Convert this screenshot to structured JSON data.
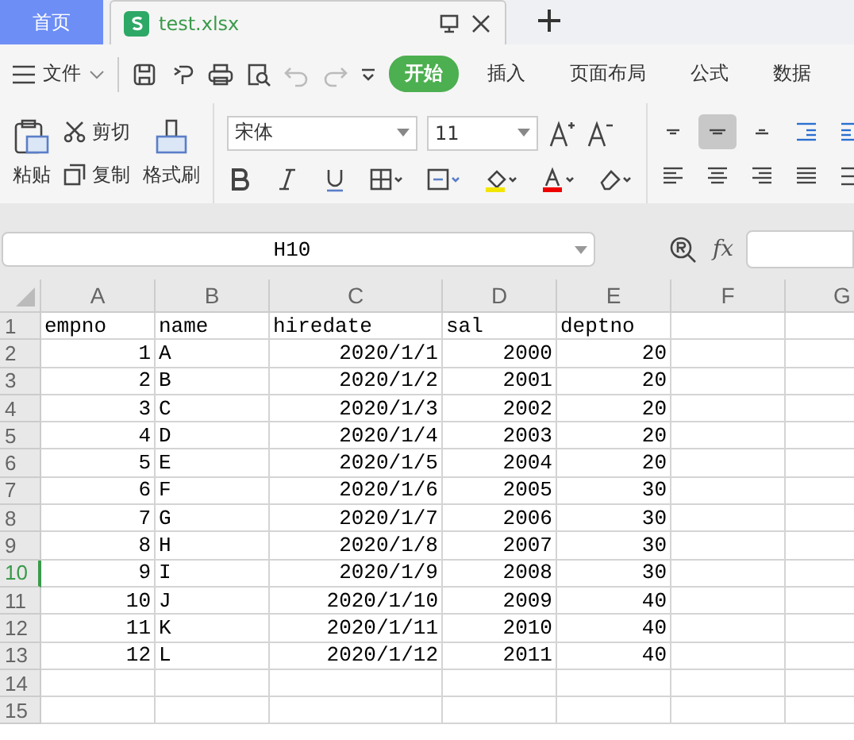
{
  "tabs": [
    {
      "label": "首页",
      "kind": "home",
      "selected": false
    },
    {
      "label": "test.xlsx",
      "kind": "file",
      "selected": true
    }
  ],
  "menu": {
    "label": "文件"
  },
  "ribbon_tabs": [
    {
      "label": "开始",
      "selected": true
    },
    {
      "label": "插入",
      "selected": false
    },
    {
      "label": "页面布局",
      "selected": false
    },
    {
      "label": "公式",
      "selected": false
    },
    {
      "label": "数据",
      "selected": false
    }
  ],
  "clipboard": {
    "paste": "粘贴",
    "cut": "剪切",
    "copy": "复制",
    "format_painter": "格式刷"
  },
  "font": {
    "name": "宋体",
    "size": "11"
  },
  "align_buttons": [
    {
      "kind": "top",
      "selected": false
    },
    {
      "kind": "middle",
      "selected": true
    },
    {
      "kind": "bottom",
      "selected": false
    },
    {
      "kind": "outdent",
      "selected": false
    },
    {
      "kind": "indent",
      "selected": false
    },
    {
      "kind": "left",
      "selected": false
    },
    {
      "kind": "center",
      "selected": false
    },
    {
      "kind": "right",
      "selected": false
    },
    {
      "kind": "justify",
      "selected": false
    },
    {
      "kind": "distribute",
      "selected": false
    }
  ],
  "name_box": {
    "value": "H10"
  },
  "function_label": "fx",
  "columns": [
    {
      "label": "A",
      "kind": "normal"
    },
    {
      "label": "B",
      "kind": "normal"
    },
    {
      "label": "C",
      "kind": "wide"
    },
    {
      "label": "D",
      "kind": "normal"
    },
    {
      "label": "E",
      "kind": "normal"
    },
    {
      "label": "F",
      "kind": "normal"
    },
    {
      "label": "G",
      "kind": "normal"
    }
  ],
  "rows": [
    {
      "header": "1",
      "selected": false,
      "cells": [
        {
          "text": "empno",
          "kind": "text"
        },
        {
          "text": "name",
          "kind": "text"
        },
        {
          "text": "hiredate",
          "kind": "text"
        },
        {
          "text": "sal",
          "kind": "text"
        },
        {
          "text": "deptno",
          "kind": "text"
        }
      ]
    },
    {
      "header": "2",
      "selected": false,
      "cells": [
        {
          "text": "1",
          "kind": "number"
        },
        {
          "text": "A",
          "kind": "text"
        },
        {
          "text": "2020/1/1",
          "kind": "number"
        },
        {
          "text": "2000",
          "kind": "number"
        },
        {
          "text": "20",
          "kind": "number"
        }
      ]
    },
    {
      "header": "3",
      "selected": false,
      "cells": [
        {
          "text": "2",
          "kind": "number"
        },
        {
          "text": "B",
          "kind": "text"
        },
        {
          "text": "2020/1/2",
          "kind": "number"
        },
        {
          "text": "2001",
          "kind": "number"
        },
        {
          "text": "20",
          "kind": "number"
        }
      ]
    },
    {
      "header": "4",
      "selected": false,
      "cells": [
        {
          "text": "3",
          "kind": "number"
        },
        {
          "text": "C",
          "kind": "text"
        },
        {
          "text": "2020/1/3",
          "kind": "number"
        },
        {
          "text": "2002",
          "kind": "number"
        },
        {
          "text": "20",
          "kind": "number"
        }
      ]
    },
    {
      "header": "5",
      "selected": false,
      "cells": [
        {
          "text": "4",
          "kind": "number"
        },
        {
          "text": "D",
          "kind": "text"
        },
        {
          "text": "2020/1/4",
          "kind": "number"
        },
        {
          "text": "2003",
          "kind": "number"
        },
        {
          "text": "20",
          "kind": "number"
        }
      ]
    },
    {
      "header": "6",
      "selected": false,
      "cells": [
        {
          "text": "5",
          "kind": "number"
        },
        {
          "text": "E",
          "kind": "text"
        },
        {
          "text": "2020/1/5",
          "kind": "number"
        },
        {
          "text": "2004",
          "kind": "number"
        },
        {
          "text": "20",
          "kind": "number"
        }
      ]
    },
    {
      "header": "7",
      "selected": false,
      "cells": [
        {
          "text": "6",
          "kind": "number"
        },
        {
          "text": "F",
          "kind": "text"
        },
        {
          "text": "2020/1/6",
          "kind": "number"
        },
        {
          "text": "2005",
          "kind": "number"
        },
        {
          "text": "30",
          "kind": "number"
        }
      ]
    },
    {
      "header": "8",
      "selected": false,
      "cells": [
        {
          "text": "7",
          "kind": "number"
        },
        {
          "text": "G",
          "kind": "text"
        },
        {
          "text": "2020/1/7",
          "kind": "number"
        },
        {
          "text": "2006",
          "kind": "number"
        },
        {
          "text": "30",
          "kind": "number"
        }
      ]
    },
    {
      "header": "9",
      "selected": false,
      "cells": [
        {
          "text": "8",
          "kind": "number"
        },
        {
          "text": "H",
          "kind": "text"
        },
        {
          "text": "2020/1/8",
          "kind": "number"
        },
        {
          "text": "2007",
          "kind": "number"
        },
        {
          "text": "30",
          "kind": "number"
        }
      ]
    },
    {
      "header": "10",
      "selected": true,
      "cells": [
        {
          "text": "9",
          "kind": "number"
        },
        {
          "text": "I",
          "kind": "text"
        },
        {
          "text": "2020/1/9",
          "kind": "number"
        },
        {
          "text": "2008",
          "kind": "number"
        },
        {
          "text": "30",
          "kind": "number"
        }
      ]
    },
    {
      "header": "11",
      "selected": false,
      "cells": [
        {
          "text": "10",
          "kind": "number"
        },
        {
          "text": "J",
          "kind": "text"
        },
        {
          "text": "2020/1/10",
          "kind": "number"
        },
        {
          "text": "2009",
          "kind": "number"
        },
        {
          "text": "40",
          "kind": "number"
        }
      ]
    },
    {
      "header": "12",
      "selected": false,
      "cells": [
        {
          "text": "11",
          "kind": "number"
        },
        {
          "text": "K",
          "kind": "text"
        },
        {
          "text": "2020/1/11",
          "kind": "number"
        },
        {
          "text": "2010",
          "kind": "number"
        },
        {
          "text": "40",
          "kind": "number"
        }
      ]
    },
    {
      "header": "13",
      "selected": false,
      "cells": [
        {
          "text": "12",
          "kind": "number"
        },
        {
          "text": "L",
          "kind": "text"
        },
        {
          "text": "2020/1/12",
          "kind": "number"
        },
        {
          "text": "2011",
          "kind": "number"
        },
        {
          "text": "40",
          "kind": "number"
        }
      ]
    },
    {
      "header": "14",
      "selected": false,
      "cells": []
    },
    {
      "header": "15",
      "selected": false,
      "cells": []
    }
  ]
}
